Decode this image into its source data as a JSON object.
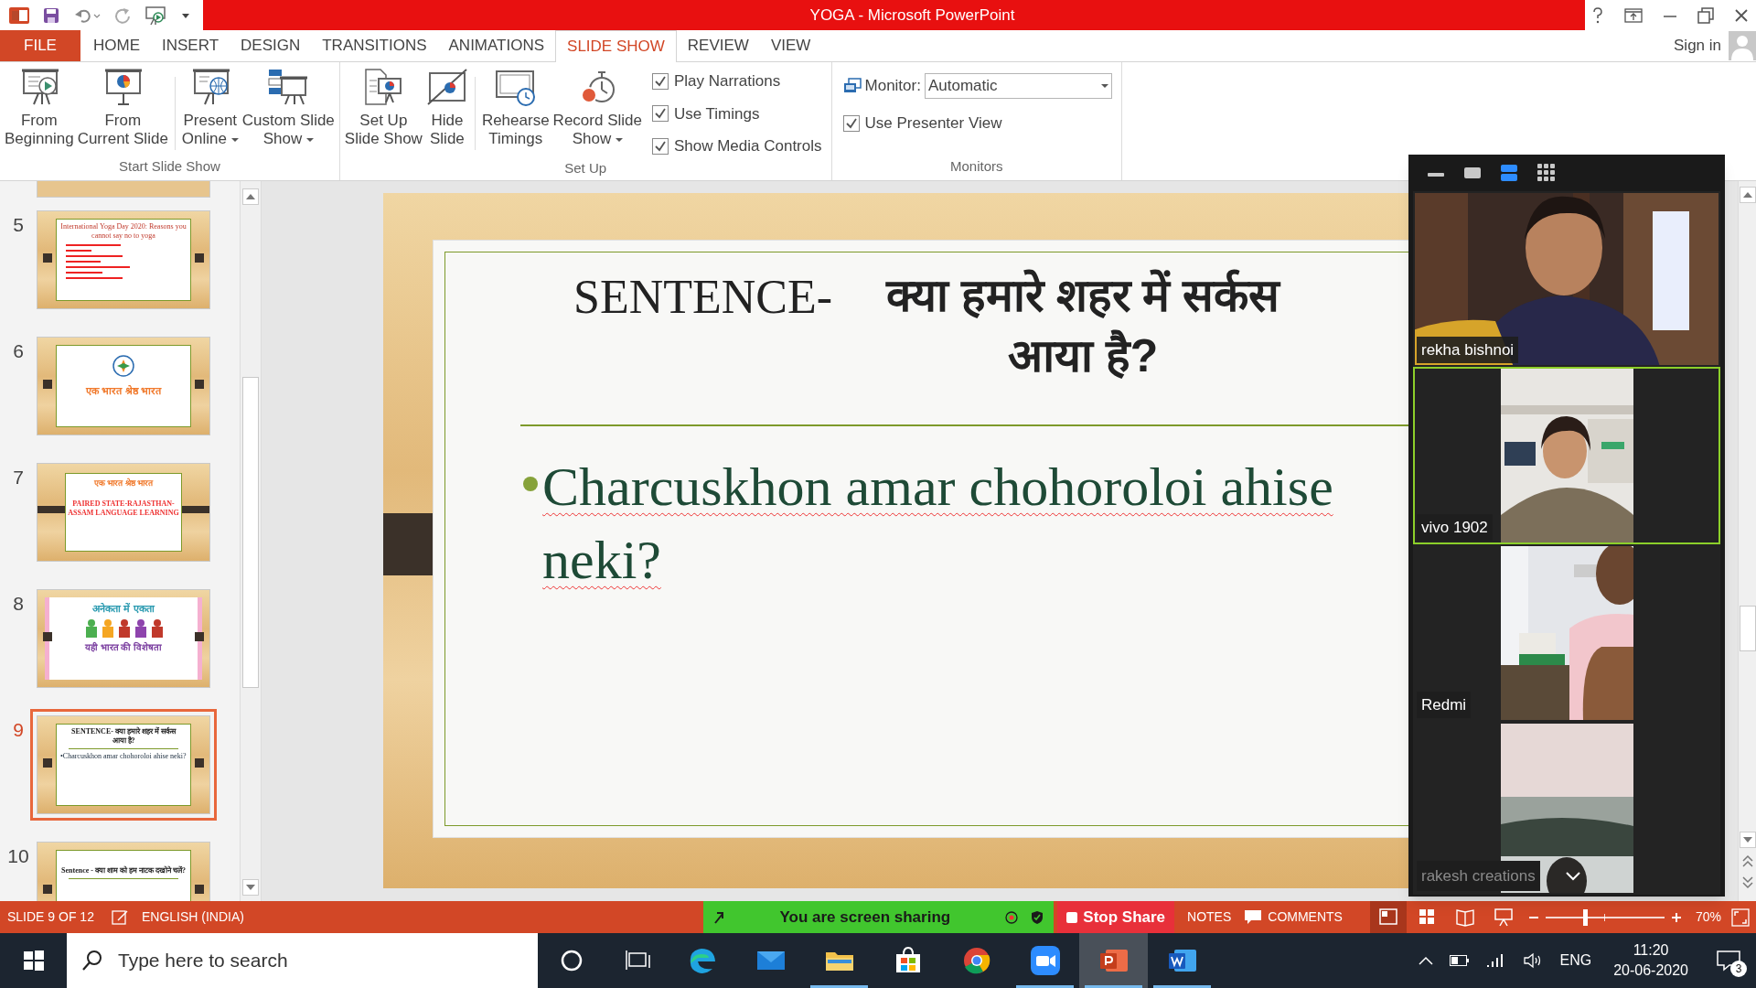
{
  "window": {
    "title": "YOGA - Microsoft PowerPoint"
  },
  "tabs": [
    {
      "label": "FILE",
      "kind": "file",
      "selected": false
    },
    {
      "label": "HOME",
      "kind": "tab",
      "selected": false
    },
    {
      "label": "INSERT",
      "kind": "tab",
      "selected": false
    },
    {
      "label": "DESIGN",
      "kind": "tab",
      "selected": false
    },
    {
      "label": "TRANSITIONS",
      "kind": "tab",
      "selected": false
    },
    {
      "label": "ANIMATIONS",
      "kind": "tab",
      "selected": false
    },
    {
      "label": "SLIDE SHOW",
      "kind": "tab",
      "selected": true
    },
    {
      "label": "REVIEW",
      "kind": "tab",
      "selected": false
    },
    {
      "label": "VIEW",
      "kind": "tab",
      "selected": false
    }
  ],
  "sign_in": "Sign in",
  "ribbon": {
    "groups": [
      {
        "label": "Start Slide Show",
        "buttons": [
          {
            "lines": [
              "From",
              "Beginning"
            ],
            "kind": "play",
            "menu": false
          },
          {
            "lines": [
              "From",
              "Current Slide"
            ],
            "kind": "pie",
            "menu": false
          },
          {
            "lines": [
              "Present",
              "Online"
            ],
            "kind": "globe",
            "menu": true
          },
          {
            "lines": [
              "Custom Slide",
              "Show"
            ],
            "kind": "custom",
            "menu": true
          }
        ]
      },
      {
        "label": "Set Up",
        "buttons": [
          {
            "lines": [
              "Set Up",
              "Slide Show"
            ],
            "kind": "setup",
            "menu": false
          },
          {
            "lines": [
              "Hide",
              "Slide"
            ],
            "kind": "hide",
            "menu": false
          },
          {
            "lines": [
              "Rehearse",
              "Timings"
            ],
            "kind": "timer",
            "menu": false
          },
          {
            "lines": [
              "Record Slide",
              "Show"
            ],
            "kind": "record",
            "menu": true
          }
        ],
        "checkboxes": [
          {
            "label": "Play Narrations",
            "checked": true
          },
          {
            "label": "Use Timings",
            "checked": true
          },
          {
            "label": "Show Media Controls",
            "checked": true
          }
        ]
      },
      {
        "label": "Monitors",
        "monitor": {
          "label": "Monitor:",
          "value": "Automatic"
        },
        "checkboxes": [
          {
            "label": "Use Presenter View",
            "checked": true
          }
        ]
      }
    ]
  },
  "thumbnails": [
    {
      "number": "5",
      "kind": "list",
      "selected": false,
      "title": "International Yoga Day 2020: Reasons you cannot say no to yoga"
    },
    {
      "number": "6",
      "kind": "logo",
      "selected": false,
      "title": "एक भारत श्रेष्ठ भारत"
    },
    {
      "number": "7",
      "kind": "banner",
      "selected": false,
      "title": "एक भारत श्रेष्ठ भारत",
      "subtitle": "PAIRED STATE-RAJASTHAN-ASSAM LANGUAGE LEARNING"
    },
    {
      "number": "8",
      "kind": "unity",
      "selected": false,
      "title": "अनेकता में एकता",
      "subtitle": "यही भारत की विशेषता"
    },
    {
      "number": "9",
      "kind": "sentence",
      "selected": true,
      "title": "SENTENCE-   क्या हमारे शहर में सर्कस आया है?",
      "subtitle": "•Charcuskhon amar chohoroloi ahise neki?"
    },
    {
      "number": "10",
      "kind": "sentence_cut",
      "selected": false,
      "title": "Sentence - क्या शाम को हम नाटक दखोने चलें?"
    }
  ],
  "slide": {
    "title_prefix": "SENTENCE-",
    "title": "क्या हमारे शहर में सर्कस आया है?",
    "bullet": "Charcuskhon amar chohoroloi ahise neki?"
  },
  "meeting": {
    "views": [
      {
        "kind": "minimize",
        "selected": false
      },
      {
        "kind": "single",
        "selected": false
      },
      {
        "kind": "speaker",
        "selected": true
      },
      {
        "kind": "grid",
        "selected": false
      }
    ],
    "tiles": [
      {
        "name": "rekha bishnoi",
        "kind": "wide",
        "highlighted": false
      },
      {
        "name": "vivo 1902",
        "kind": "narrow",
        "highlighted": true
      },
      {
        "name": "Redmi",
        "kind": "narrow",
        "highlighted": false
      },
      {
        "name": "rakesh creations",
        "kind": "faded",
        "highlighted": false
      }
    ]
  },
  "status_bar": {
    "slide": "SLIDE 9 OF 12",
    "language": "ENGLISH (INDIA)",
    "sharing": "You are screen sharing",
    "stop": "Stop Share",
    "notes": "NOTES",
    "comments": "COMMENTS",
    "zoom": {
      "level": 0.33,
      "reading": "70%"
    }
  },
  "taskbar": {
    "search": {
      "placeholder": "Type here to search"
    },
    "apps": [
      {
        "kind": "edge",
        "running": false,
        "active": false
      },
      {
        "kind": "mail",
        "running": false,
        "active": false
      },
      {
        "kind": "folder",
        "running": true,
        "active": false
      },
      {
        "kind": "store",
        "running": false,
        "active": false
      },
      {
        "kind": "chrome",
        "running": false,
        "active": false
      },
      {
        "kind": "camera",
        "running": true,
        "active": false
      },
      {
        "kind": "powerpoint",
        "running": true,
        "active": true
      },
      {
        "kind": "word",
        "running": true,
        "active": false
      }
    ],
    "language": "ENG",
    "time": "11:20",
    "date": "20-06-2020",
    "notifications": "3"
  }
}
